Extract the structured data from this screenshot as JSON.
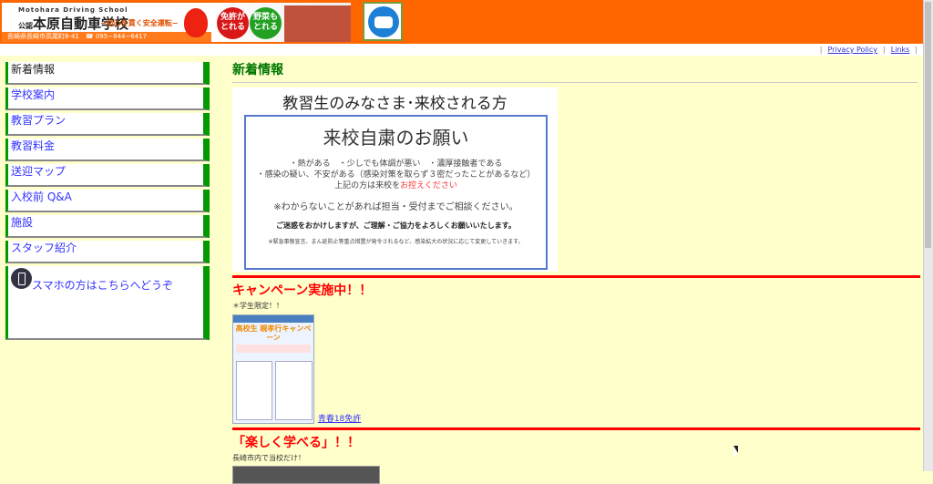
{
  "header": {
    "banner": {
      "sub": "Motohara Driving School",
      "prefix": "公認",
      "name": "本原自動車学校",
      "motto": "−初心を貫く安全運転−",
      "address": "長崎県長崎市高尾町8-41",
      "phone": "095−844−6417",
      "badge1": "免許がとれる",
      "badge2": "野菜もとれる"
    },
    "badge_icon": "car-badge-icon"
  },
  "toplinks": [
    {
      "label": "Privacy Policy"
    },
    {
      "label": "Links"
    }
  ],
  "sidebar": {
    "items": [
      {
        "label": "新着情報",
        "current": true
      },
      {
        "label": "学校案内"
      },
      {
        "label": "教習プラン"
      },
      {
        "label": "教習料金"
      },
      {
        "label": "送迎マップ"
      },
      {
        "label": "入校前 Q&A"
      },
      {
        "label": "施設"
      },
      {
        "label": "スタッフ紹介"
      },
      {
        "label": "スマホの方はこちらへどうぞ",
        "icon": "smartphone-icon"
      }
    ]
  },
  "main": {
    "title": "新着情報",
    "notice": {
      "heading": "教習生のみなさま･来校される方",
      "title": "来校自粛のお願い",
      "line1": "・熱がある　・少しでも体調が悪い　・濃厚接触者である",
      "line2": "・感染の疑い、不安がある（感染対策を取らず３密だったことがあるなど）",
      "line3a": "上記の方は来校を",
      "line3b": "お控えください",
      "line4": "※わからないことがあれば担当・受付までご相談ください。",
      "line5": "ご迷惑をおかけしますが、ご理解・ご協力をよろしくお願いいたします。",
      "line6": "※緊急事態宣言、まん延防止等重点措置が発令されるなど、感染拡大の状況に応じて変更していきます。"
    },
    "campaign": {
      "title": "キャンペーン実施中！！",
      "note": "＊学生限定！！",
      "flyer_head": "高校生 親孝行キャンペーン",
      "link": "青春18免許"
    },
    "fun": {
      "title": "「楽しく学べる」！！",
      "note": "長崎市内で当校だけ！"
    }
  },
  "colors": {
    "header": "#ff6600",
    "background": "#ffffcc",
    "accent_green": "#009900",
    "section_red": "#ff0000"
  }
}
